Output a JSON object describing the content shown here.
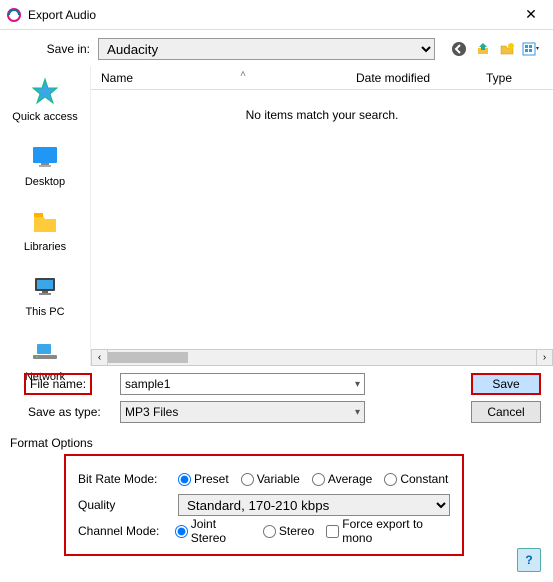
{
  "titlebar": {
    "title": "Export Audio"
  },
  "save_in": {
    "label": "Save in:",
    "value": "Audacity"
  },
  "columns": {
    "name": "Name",
    "date": "Date modified",
    "type": "Type"
  },
  "empty_message": "No items match your search.",
  "places": {
    "quick_access": "Quick access",
    "desktop": "Desktop",
    "libraries": "Libraries",
    "this_pc": "This PC",
    "network": "Network"
  },
  "file_name": {
    "label": "File name:",
    "value": "sample1"
  },
  "save_as_type": {
    "label": "Save as type:",
    "value": "MP3 Files"
  },
  "buttons": {
    "save": "Save",
    "cancel": "Cancel"
  },
  "format": {
    "title": "Format Options",
    "bit_rate_mode": {
      "label": "Bit Rate Mode:",
      "preset": "Preset",
      "variable": "Variable",
      "average": "Average",
      "constant": "Constant"
    },
    "quality": {
      "label": "Quality",
      "value": "Standard, 170-210 kbps"
    },
    "channel_mode": {
      "label": "Channel Mode:",
      "joint": "Joint Stereo",
      "stereo": "Stereo",
      "force_mono": "Force export to mono"
    }
  }
}
